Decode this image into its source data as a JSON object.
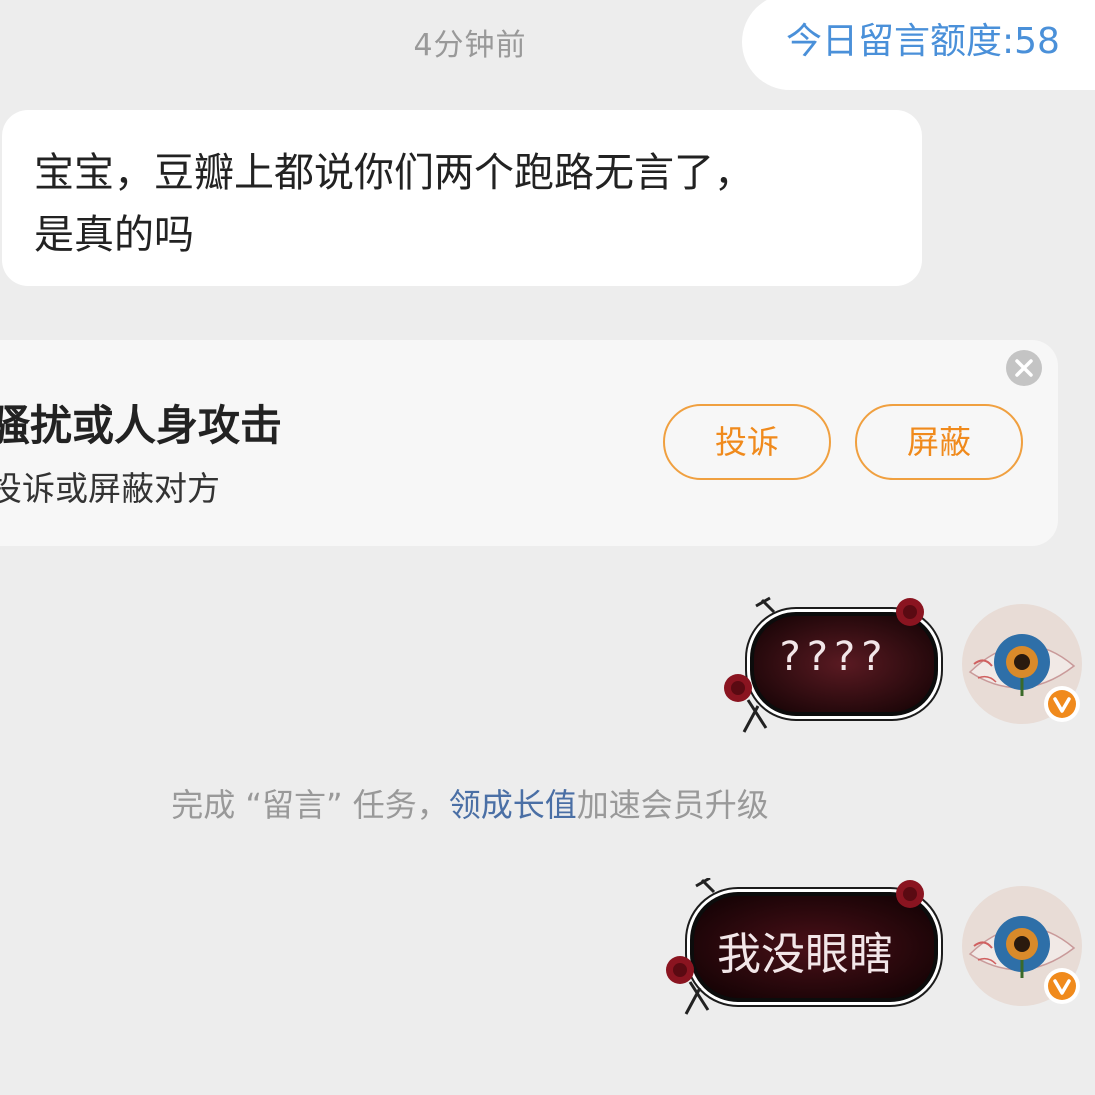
{
  "timestamp": "4分钟前",
  "quota": {
    "text": "今日留言额度:58"
  },
  "incoming_message": {
    "line1": "宝宝，豆瓣上都说你们两个跑路无言了，",
    "line2": "是真的吗"
  },
  "notice": {
    "title": "跑骚扰或人身攻击",
    "subtitle": "以投诉或屏蔽对方",
    "complain_label": "投诉",
    "block_label": "屏蔽"
  },
  "task_hint": {
    "prefix": "完成 “留言” 任务，",
    "link": "领成长值",
    "suffix": "加速会员升级"
  },
  "outgoing_messages": [
    {
      "text": "????"
    },
    {
      "text": "我没眼瞎"
    }
  ],
  "colors": {
    "background": "#ededed",
    "accent_blue": "#4a90d9",
    "accent_orange": "#f08a1c",
    "link_blue": "#4a6fa5",
    "bubble_dark": "#2a0a0e",
    "vip_badge": "#f08a1c"
  }
}
